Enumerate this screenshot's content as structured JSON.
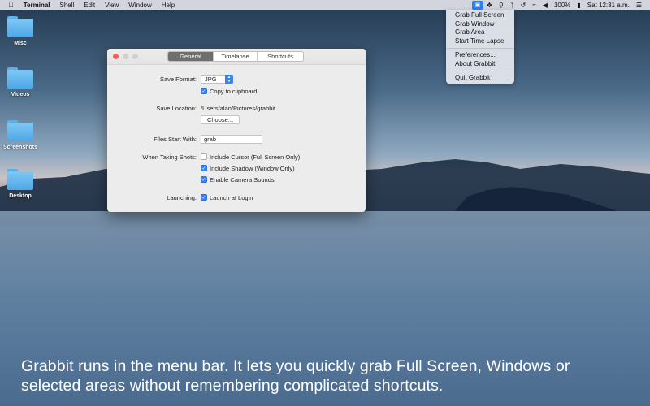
{
  "menubar": {
    "app_name": "Terminal",
    "menus": [
      "Shell",
      "Edit",
      "View",
      "Window",
      "Help"
    ],
    "battery": "100%",
    "clock": "Sat 12:31 a.m.",
    "icons": [
      "apple-icon",
      "grabbit-icon",
      "dropbox-icon",
      "search-icon",
      "bluetooth-icon",
      "time-machine-icon",
      "wifi-icon",
      "volume-icon",
      "battery-icon",
      "list-icon"
    ]
  },
  "dropdown": {
    "group1": [
      "Grab Full Screen",
      "Grab Window",
      "Grab Area",
      "Start Time Lapse"
    ],
    "group2": [
      "Preferences...",
      "About Grabbit"
    ],
    "group3": [
      "Quit Grabbit"
    ]
  },
  "desktop_icons": [
    "Misc",
    "Videos",
    "Screenshots",
    "Desktop"
  ],
  "window": {
    "tabs": [
      "General",
      "Timelapse",
      "Shortcuts"
    ],
    "active_tab": "General",
    "save_format_label": "Save Format:",
    "save_format_value": "JPG",
    "copy_clipboard_label": "Copy to clipboard",
    "save_location_label": "Save Location:",
    "save_location_value": "/Users/alan/Pictures/grabbit",
    "choose_button": "Choose...",
    "files_start_label": "Files Start With:",
    "files_start_value": "grab",
    "taking_shots_label": "When Taking Shots:",
    "include_cursor_label": "Include Cursor (Full Screen Only)",
    "include_shadow_label": "Include Shadow (Window Only)",
    "camera_sounds_label": "Enable Camera Sounds",
    "launching_label": "Launching:",
    "launch_login_label": "Launch at Login",
    "checkbox_states": {
      "copy_clipboard": true,
      "include_cursor": false,
      "include_shadow": true,
      "camera_sounds": true,
      "launch_login": true
    }
  },
  "caption": {
    "line1": "Grabbit runs in the menu bar. It lets you quickly grab Full Screen, Windows or",
    "line2": "selected areas without remembering complicated shortcuts."
  },
  "colors": {
    "accent": "#3b82f0",
    "close": "#fc5f57"
  }
}
